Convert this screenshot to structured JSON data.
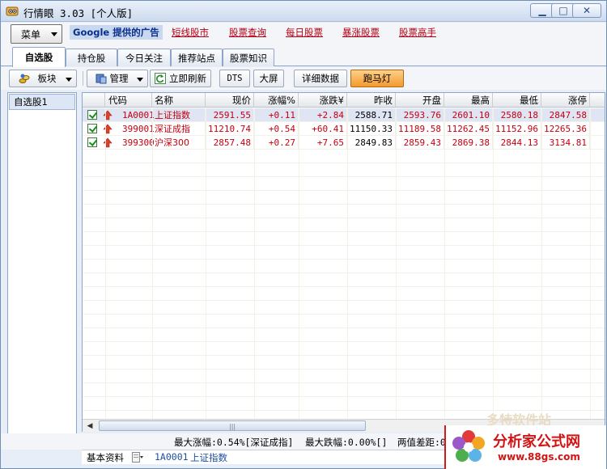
{
  "window": {
    "title": "行情眼 3.03 [个人版]",
    "min_glyph": "▁",
    "max_glyph": "□",
    "close_glyph": "✕"
  },
  "menu": {
    "dropdown_label": "菜单",
    "ad_label": "Google 提供的广告",
    "ad_links": [
      "短线股市",
      "股票查询",
      "每日股票",
      "暴涨股票",
      "股票高手"
    ]
  },
  "tabs": [
    "自选股",
    "持仓股",
    "今日关注",
    "推荐站点",
    "股票知识"
  ],
  "toolbar": {
    "sector_label": "板块",
    "manage_label": "管理",
    "refresh_label": "立即刷新",
    "dts_label": "DTS",
    "bigscreen_label": "大屏",
    "detail_label": "详细数据",
    "marquee_label": "跑马灯"
  },
  "left_panel": {
    "items": [
      "自选股1"
    ]
  },
  "grid": {
    "columns": [
      "代码",
      "名称",
      "现价",
      "涨幅%",
      "涨跌¥",
      "昨收",
      "开盘",
      "最高",
      "最低",
      "涨停"
    ],
    "rows": [
      {
        "code": "1A0001",
        "name": "上证指数",
        "price": "2591.55",
        "pct": "+0.11",
        "change": "+2.84",
        "prev_close": "2588.71",
        "open": "2593.76",
        "high": "2601.10",
        "low": "2580.18",
        "limit_up": "2847.58",
        "checked": true
      },
      {
        "code": "399001",
        "name": "深证成指",
        "price": "11210.74",
        "pct": "+0.54",
        "change": "+60.41",
        "prev_close": "11150.33",
        "open": "11189.58",
        "high": "11262.45",
        "low": "11152.96",
        "limit_up": "12265.36",
        "checked": true
      },
      {
        "code": "399300",
        "name": "沪深300",
        "price": "2857.48",
        "pct": "+0.27",
        "change": "+7.65",
        "prev_close": "2849.83",
        "open": "2859.43",
        "high": "2869.38",
        "low": "2844.13",
        "limit_up": "3134.81",
        "checked": true
      }
    ]
  },
  "status": {
    "max_rise": "最大涨幅:0.54%[深证成指]",
    "max_fall": "最大跌幅:0.00%[]",
    "diff": "两值差距:0",
    "basic_info": "基本资料",
    "current_code": "1A0001",
    "current_name": "上证指数"
  },
  "watermark": {
    "title": "分析家公式网",
    "url": "www.88gs.com",
    "faded": "多特软件站"
  },
  "colors": {
    "accent_red": "#c4000f",
    "selected_row": "#dfe5f3",
    "marquee_button": "#f39a2e"
  }
}
